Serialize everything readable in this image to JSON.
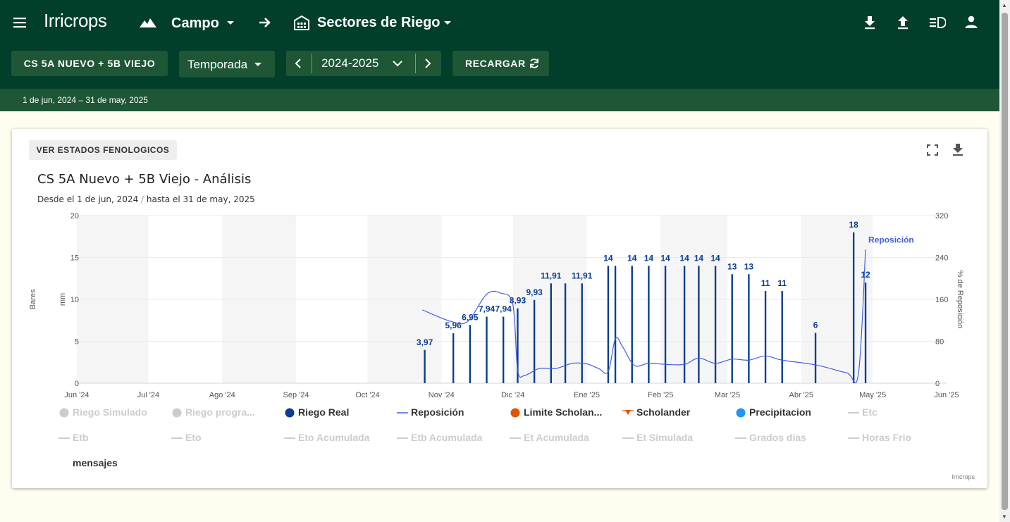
{
  "app": {
    "logo": "Irricrops"
  },
  "header": {
    "campo_label": "Campo",
    "sectores_label": "Sectores de Riego"
  },
  "toolbar": {
    "sector_button": "CS 5A NUEVO + 5B VIEJO",
    "period_select": "Temporada",
    "season_value": "2024-2025",
    "reload_label": "RECARGAR"
  },
  "date_range": "1 de jun, 2024 – 31 de may, 2025",
  "panel": {
    "fenologicos_button": "VER ESTADOS FENOLOGICOS",
    "title": "CS 5A Nuevo + 5B Viejo - Análisis",
    "subtitle_from": "Desde el 1 de jun, 2024",
    "subtitle_sep": "/",
    "subtitle_to": "hasta el 31 de may, 2025",
    "credits": "Irricrops"
  },
  "chart_data": {
    "type": "bar",
    "x_ticks": [
      "Jun '24",
      "Jul '24",
      "Ago '24",
      "Sep '24",
      "Oct '24",
      "Nov '24",
      "Dic '24",
      "Ene '25",
      "Feb '25",
      "Mar '25",
      "Abr '25",
      "May '25",
      "Jun '25"
    ],
    "xlim": [
      "2024-06-01",
      "2025-06-01"
    ],
    "y_left_outer": {
      "label": "Bares"
    },
    "y_left": {
      "label": "mm",
      "ticks": [
        0,
        5,
        10,
        15,
        20
      ],
      "ylim": [
        0,
        20
      ]
    },
    "y_right": {
      "label": "% de Reposición",
      "ticks": [
        0,
        80,
        160,
        240,
        320
      ],
      "ylim": [
        0,
        320
      ]
    },
    "plot_bands": [
      [
        "2024-06-01",
        "2024-07-01"
      ],
      [
        "2024-08-01",
        "2024-09-01"
      ],
      [
        "2024-10-01",
        "2024-11-01"
      ],
      [
        "2024-12-01",
        "2025-01-01"
      ],
      [
        "2025-02-01",
        "2025-03-01"
      ],
      [
        "2025-04-01",
        "2025-05-01"
      ]
    ],
    "series": [
      {
        "name": "Riego Real",
        "color": "#0a3d91",
        "points": [
          {
            "date": "2024-10-25",
            "value": 3.97,
            "label": "3,97"
          },
          {
            "date": "2024-11-06",
            "value": 5.96,
            "label": "5,96"
          },
          {
            "date": "2024-11-13",
            "value": 6.95,
            "label": "6,95"
          },
          {
            "date": "2024-11-20",
            "value": 7.94,
            "label": "7,94"
          },
          {
            "date": "2024-11-27",
            "value": 7.94,
            "label": "7,94"
          },
          {
            "date": "2024-12-03",
            "value": 8.93,
            "label": "8,93"
          },
          {
            "date": "2024-12-10",
            "value": 9.93,
            "label": "9,93"
          },
          {
            "date": "2024-12-17",
            "value": 11.91,
            "label": "11,91"
          },
          {
            "date": "2024-12-23",
            "value": 11.91,
            "label": ""
          },
          {
            "date": "2024-12-30",
            "value": 11.91,
            "label": "11,91"
          },
          {
            "date": "2025-01-10",
            "value": 14,
            "label": "14"
          },
          {
            "date": "2025-01-13",
            "value": 14,
            "label": ""
          },
          {
            "date": "2025-01-20",
            "value": 14,
            "label": "14"
          },
          {
            "date": "2025-01-27",
            "value": 14,
            "label": "14"
          },
          {
            "date": "2025-02-03",
            "value": 14,
            "label": "14"
          },
          {
            "date": "2025-02-11",
            "value": 14,
            "label": "14"
          },
          {
            "date": "2025-02-17",
            "value": 14,
            "label": "14"
          },
          {
            "date": "2025-02-24",
            "value": 14,
            "label": "14"
          },
          {
            "date": "2025-03-03",
            "value": 13,
            "label": "13"
          },
          {
            "date": "2025-03-10",
            "value": 13,
            "label": "13"
          },
          {
            "date": "2025-03-17",
            "value": 11,
            "label": "11"
          },
          {
            "date": "2025-03-24",
            "value": 11,
            "label": "11"
          },
          {
            "date": "2025-04-07",
            "value": 6,
            "label": "6"
          },
          {
            "date": "2025-04-23",
            "value": 18,
            "label": "18"
          },
          {
            "date": "2025-04-28",
            "value": 12,
            "label": "12"
          }
        ]
      },
      {
        "name": "Reposición",
        "color": "#4060e0",
        "axis": "right",
        "points": [
          [
            "2024-10-24",
            140
          ],
          [
            "2024-11-05",
            118
          ],
          [
            "2024-11-12",
            118
          ],
          [
            "2024-11-20",
            170
          ],
          [
            "2024-11-26",
            172
          ],
          [
            "2024-12-01",
            150
          ],
          [
            "2024-12-03",
            25
          ],
          [
            "2024-12-06",
            15
          ],
          [
            "2024-12-12",
            28
          ],
          [
            "2024-12-19",
            28
          ],
          [
            "2024-12-26",
            38
          ],
          [
            "2025-01-01",
            37
          ],
          [
            "2025-01-06",
            28
          ],
          [
            "2025-01-10",
            22
          ],
          [
            "2025-01-13",
            85
          ],
          [
            "2025-01-16",
            70
          ],
          [
            "2025-01-21",
            34
          ],
          [
            "2025-01-27",
            38
          ],
          [
            "2025-02-03",
            36
          ],
          [
            "2025-02-11",
            36
          ],
          [
            "2025-02-17",
            48
          ],
          [
            "2025-02-24",
            38
          ],
          [
            "2025-03-03",
            46
          ],
          [
            "2025-03-10",
            44
          ],
          [
            "2025-03-17",
            52
          ],
          [
            "2025-03-24",
            44
          ],
          [
            "2025-04-07",
            35
          ],
          [
            "2025-04-20",
            20
          ],
          [
            "2025-04-25",
            18
          ],
          [
            "2025-04-28",
            255
          ]
        ],
        "label": "Reposición"
      }
    ]
  },
  "legend": [
    {
      "name": "Riego Simulado",
      "active": false,
      "symbol": "circle",
      "color": "#cccccc"
    },
    {
      "name": "Riego progra...",
      "active": false,
      "symbol": "circle",
      "color": "#cccccc"
    },
    {
      "name": "Riego Real",
      "active": true,
      "symbol": "circle",
      "color": "#0a3d91"
    },
    {
      "name": "Reposición",
      "active": true,
      "symbol": "line",
      "color": "#4060e0"
    },
    {
      "name": "Limite Scholan...",
      "active": true,
      "symbol": "circle",
      "color": "#e65100"
    },
    {
      "name": "Scholander",
      "active": true,
      "symbol": "triangle",
      "color": "#e65100"
    },
    {
      "name": "Precipitacion",
      "active": true,
      "symbol": "circle",
      "color": "#2196f3"
    },
    {
      "name": "Etc",
      "active": false,
      "symbol": "line",
      "color": "#cccccc"
    },
    {
      "name": "Etb",
      "active": false,
      "symbol": "line",
      "color": "#cccccc"
    },
    {
      "name": "Eto",
      "active": false,
      "symbol": "line",
      "color": "#cccccc"
    },
    {
      "name": "Eto Acumulada",
      "active": false,
      "symbol": "line",
      "color": "#cccccc"
    },
    {
      "name": "Etb Acumulada",
      "active": false,
      "symbol": "line",
      "color": "#cccccc"
    },
    {
      "name": "Et Acumulada",
      "active": false,
      "symbol": "line",
      "color": "#cccccc"
    },
    {
      "name": "Et Simulada",
      "active": false,
      "symbol": "line",
      "color": "#cccccc"
    },
    {
      "name": "Grados dias",
      "active": false,
      "symbol": "line",
      "color": "#cccccc"
    },
    {
      "name": "Horas Frio",
      "active": false,
      "symbol": "line",
      "color": "#cccccc"
    },
    {
      "name": "mensajes",
      "active": true,
      "symbol": "none",
      "color": "#333333"
    }
  ]
}
